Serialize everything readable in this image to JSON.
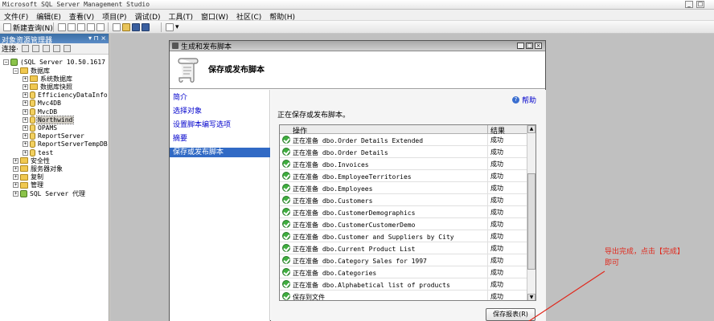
{
  "window": {
    "title": "Microsoft SQL Server Management Studio",
    "min": "_",
    "max": "□"
  },
  "menu": [
    "文件(F)",
    "编辑(E)",
    "查看(V)",
    "项目(P)",
    "调试(D)",
    "工具(T)",
    "窗口(W)",
    "社区(C)",
    "帮助(H)"
  ],
  "toolbar": {
    "new_query": "新建查询(N)"
  },
  "object_explorer": {
    "title": "对象资源管理器",
    "pin": "▾ ⊓ ×",
    "connect": "连接·",
    "server": "(SQL Server 10.50.1617 -",
    "tree": [
      {
        "label": "数据库",
        "level": 1,
        "exp": "−",
        "kind": "folder"
      },
      {
        "label": "系统数据库",
        "level": 2,
        "exp": "+",
        "kind": "folder"
      },
      {
        "label": "数据库快照",
        "level": 2,
        "exp": "+",
        "kind": "folder"
      },
      {
        "label": "EfficiencyDataInfo",
        "level": 2,
        "exp": "+",
        "kind": "db"
      },
      {
        "label": "Mvc4DB",
        "level": 2,
        "exp": "+",
        "kind": "db"
      },
      {
        "label": "MvcDB",
        "level": 2,
        "exp": "+",
        "kind": "db"
      },
      {
        "label": "Northwind",
        "level": 2,
        "exp": "+",
        "kind": "db",
        "selected": true
      },
      {
        "label": "OPAMS",
        "level": 2,
        "exp": "+",
        "kind": "db"
      },
      {
        "label": "ReportServer",
        "level": 2,
        "exp": "+",
        "kind": "db"
      },
      {
        "label": "ReportServerTempDB",
        "level": 2,
        "exp": "+",
        "kind": "db"
      },
      {
        "label": "test",
        "level": 2,
        "exp": "+",
        "kind": "db"
      },
      {
        "label": "安全性",
        "level": 1,
        "exp": "+",
        "kind": "folder"
      },
      {
        "label": "服务器对象",
        "level": 1,
        "exp": "+",
        "kind": "folder"
      },
      {
        "label": "复制",
        "level": 1,
        "exp": "+",
        "kind": "folder"
      },
      {
        "label": "管理",
        "level": 1,
        "exp": "+",
        "kind": "folder"
      },
      {
        "label": "SQL Server 代理",
        "level": 1,
        "exp": "+",
        "kind": "srv"
      }
    ]
  },
  "dialog": {
    "title": "生成和发布脚本",
    "header": "保存或发布脚本",
    "nav": [
      "简介",
      "选择对象",
      "设置脚本编写选项",
      "摘要",
      "保存或发布脚本"
    ],
    "nav_active": 4,
    "help": "帮助",
    "heading": "正在保存或发布脚本。",
    "grid": {
      "col_action": "操作",
      "col_result": "结果",
      "rows": [
        {
          "op": "正在准备 dbo.Order Details Extended",
          "res": "成功"
        },
        {
          "op": "正在准备 dbo.Order Details",
          "res": "成功"
        },
        {
          "op": "正在准备 dbo.Invoices",
          "res": "成功"
        },
        {
          "op": "正在准备 dbo.EmployeeTerritories",
          "res": "成功"
        },
        {
          "op": "正在准备 dbo.Employees",
          "res": "成功"
        },
        {
          "op": "正在准备 dbo.Customers",
          "res": "成功"
        },
        {
          "op": "正在准备 dbo.CustomerDemographics",
          "res": "成功"
        },
        {
          "op": "正在准备 dbo.CustomerCustomerDemo",
          "res": "成功"
        },
        {
          "op": "正在准备 dbo.Customer and Suppliers by City",
          "res": "成功"
        },
        {
          "op": "正在准备 dbo.Current Product List",
          "res": "成功"
        },
        {
          "op": "正在准备 dbo.Category Sales for 1997",
          "res": "成功"
        },
        {
          "op": "正在准备 dbo.Categories",
          "res": "成功"
        },
        {
          "op": "正在准备 dbo.Alphabetical list of products",
          "res": "成功"
        },
        {
          "op": "保存到文件",
          "res": "成功"
        }
      ]
    },
    "save_report": "保存报表(R)"
  },
  "annotation": {
    "text": "导出完成，点击【完成】即可",
    "color": "#e0281c"
  }
}
